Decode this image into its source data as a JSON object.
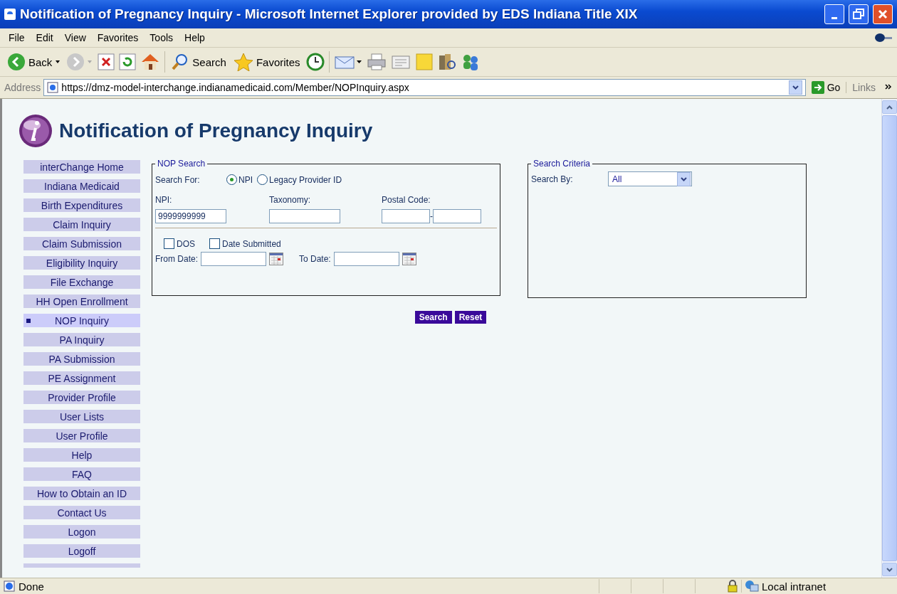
{
  "window": {
    "title": "Notification of Pregnancy Inquiry - Microsoft Internet Explorer provided by EDS Indiana Title XIX"
  },
  "menu": [
    "File",
    "Edit",
    "View",
    "Favorites",
    "Tools",
    "Help"
  ],
  "toolbar": {
    "back": "Back",
    "search": "Search",
    "favorites": "Favorites"
  },
  "address_bar": {
    "label": "Address",
    "url": "https://dmz-model-interchange.indianamedicaid.com/Member/NOPInquiry.aspx",
    "go": "Go",
    "links": "Links"
  },
  "page_title": "Notification of Pregnancy Inquiry",
  "sidebar": {
    "items": [
      {
        "label": "interChange Home",
        "selected": false
      },
      {
        "label": "Indiana Medicaid",
        "selected": false
      },
      {
        "label": "Birth Expenditures",
        "selected": false
      },
      {
        "label": "Claim Inquiry",
        "selected": false
      },
      {
        "label": "Claim Submission",
        "selected": false
      },
      {
        "label": "Eligibility Inquiry",
        "selected": false
      },
      {
        "label": "File Exchange",
        "selected": false
      },
      {
        "label": "HH Open Enrollment",
        "selected": false
      },
      {
        "label": "NOP Inquiry",
        "selected": true
      },
      {
        "label": "PA Inquiry",
        "selected": false
      },
      {
        "label": "PA Submission",
        "selected": false
      },
      {
        "label": "PE Assignment",
        "selected": false
      },
      {
        "label": "Provider Profile",
        "selected": false
      },
      {
        "label": "User Lists",
        "selected": false
      },
      {
        "label": "User Profile",
        "selected": false
      },
      {
        "label": "Help",
        "selected": false
      },
      {
        "label": "FAQ",
        "selected": false
      },
      {
        "label": "How to Obtain an ID",
        "selected": false
      },
      {
        "label": "Contact Us",
        "selected": false
      },
      {
        "label": "Logon",
        "selected": false
      },
      {
        "label": "Logoff",
        "selected": false
      }
    ]
  },
  "nop_search": {
    "legend": "NOP Search",
    "search_for": "Search For:",
    "radios": [
      {
        "label": "NPI",
        "selected": true
      },
      {
        "label": "Legacy Provider ID",
        "selected": false
      }
    ],
    "npi": {
      "label": "NPI:",
      "value": "9999999999"
    },
    "taxonomy": {
      "label": "Taxonomy:"
    },
    "postal_code": {
      "label": "Postal Code:",
      "separator": "-"
    },
    "checkboxes": [
      {
        "label": "DOS",
        "checked": false
      },
      {
        "label": "Date Submitted",
        "checked": false
      }
    ],
    "from_date": {
      "label": "From Date:"
    },
    "to_date": {
      "label": "To Date:"
    }
  },
  "search_criteria": {
    "legend": "Search Criteria",
    "search_by": "Search By:",
    "value": "All"
  },
  "buttons": [
    "Search",
    "Reset"
  ],
  "status_bar": {
    "text": "Done",
    "zone": "Local intranet"
  }
}
